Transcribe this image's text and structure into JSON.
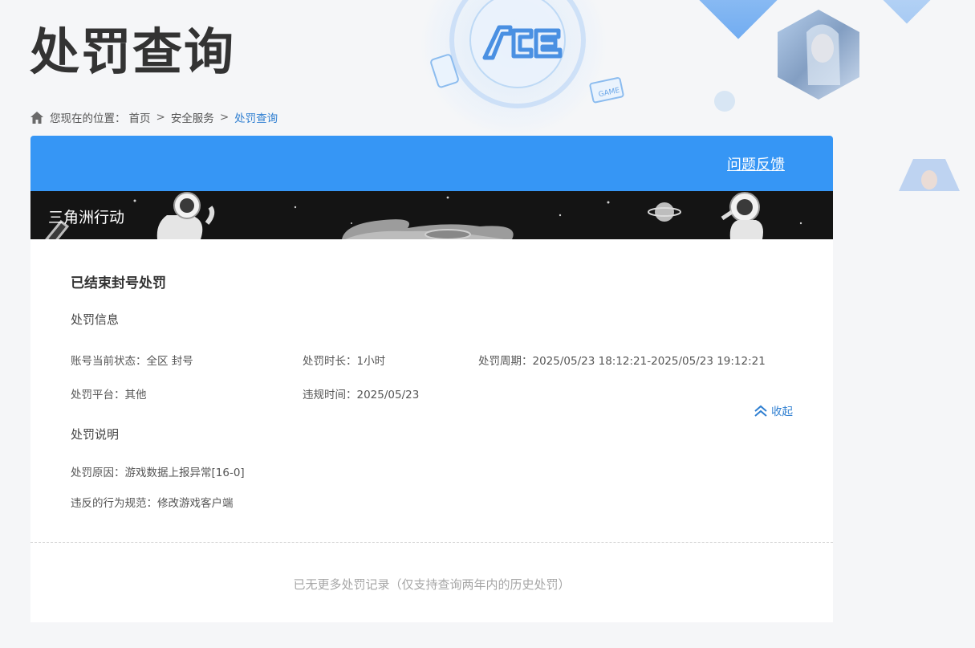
{
  "header": {
    "title": "处罚查询",
    "logo_text": "ACE",
    "game_tag_text": "GAME"
  },
  "breadcrumb": {
    "prefix": "您现在的位置：",
    "items": [
      "首页",
      "安全服务",
      "处罚查询"
    ],
    "separator": ">"
  },
  "card": {
    "feedback_label": "问题反馈",
    "game_name": "三角洲行动",
    "status_title": "已结束封号处罚",
    "info_section_title": "处罚信息",
    "info": {
      "status": "账号当前状态：全区 封号",
      "duration": "处罚时长：1小时",
      "period": "处罚周期：2025/05/23 18:12:21-2025/05/23 19:12:21",
      "platform": "处罚平台：其他",
      "violation_time": "违规时间：2025/05/23"
    },
    "explanation_section_title": "处罚说明",
    "explanation": {
      "reason": "处罚原因：游戏数据上报异常[16-0]",
      "rule": "违反的行为规范：修改游戏客户端"
    },
    "collapse_label": "收起",
    "footer_note": "已无更多处罚记录（仅支持查询两年内的历史处罚）"
  },
  "colors": {
    "accent_blue": "#3696f5",
    "link_blue": "#2f7fd1",
    "banner_dark": "#141414"
  },
  "icons": [
    "home-icon",
    "chevron-double-up-icon"
  ]
}
